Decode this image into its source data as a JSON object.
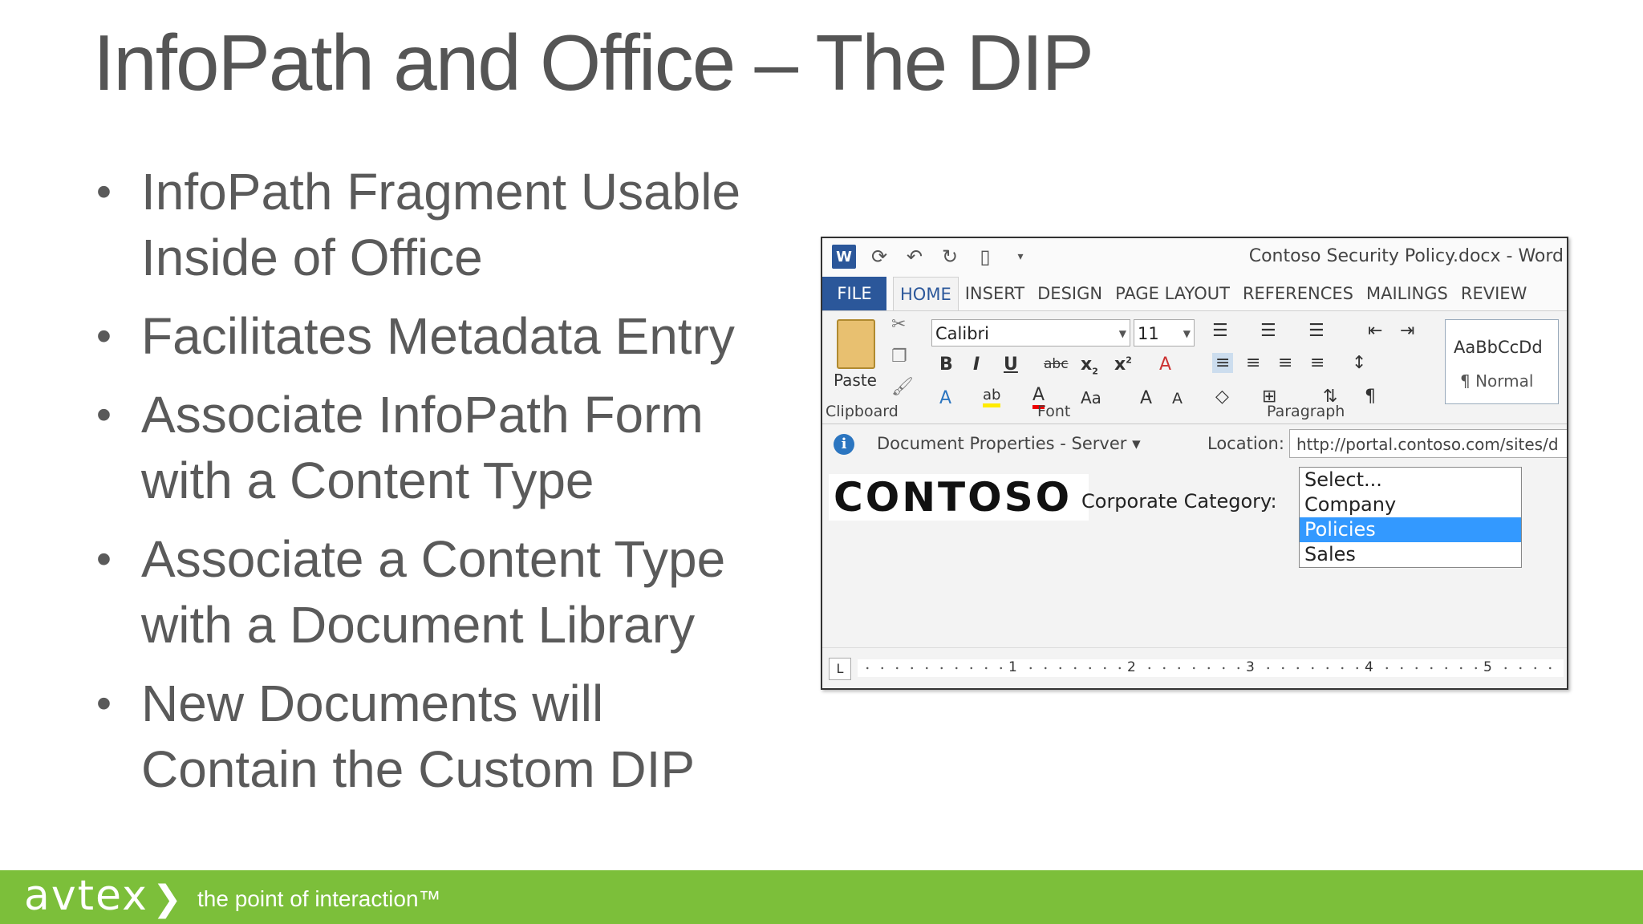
{
  "slide": {
    "title": "InfoPath and Office – The DIP",
    "bullets": [
      "InfoPath Fragment Usable Inside of Office",
      "Facilitates Metadata Entry",
      "Associate InfoPath Form with a Content Type",
      "Associate a Content Type with a Document Library",
      "New Documents will Contain the Custom DIP"
    ]
  },
  "word": {
    "window_title": "Contoso Security Policy.docx - Word",
    "tabs": [
      "FILE",
      "HOME",
      "INSERT",
      "DESIGN",
      "PAGE LAYOUT",
      "REFERENCES",
      "MAILINGS",
      "REVIEW"
    ],
    "ribbon": {
      "paste_label": "Paste",
      "font_name": "Calibri",
      "font_size": "11",
      "group_clipboard": "Clipboard",
      "group_font": "Font",
      "group_paragraph": "Paragraph",
      "style_sample": "AaBbCcDd",
      "style_name": "¶ Normal"
    },
    "dip": {
      "panel_title": "Document Properties - Server ▾",
      "location_label": "Location:",
      "location_value": "http://portal.contoso.com/sites/d",
      "logo_text": "CONTOSO",
      "category_label": "Corporate Category:",
      "category_options": [
        "Select...",
        "Company",
        "Policies",
        "Sales"
      ],
      "category_selected": "Policies"
    },
    "ruler_numbers": [
      "1",
      "2",
      "3",
      "4",
      "5"
    ]
  },
  "footer": {
    "brand": "avtex",
    "tagline": "the point of interaction™"
  },
  "colors": {
    "footer_green": "#7cbf3a",
    "word_blue": "#2b579a",
    "selection_blue": "#3399ff"
  }
}
